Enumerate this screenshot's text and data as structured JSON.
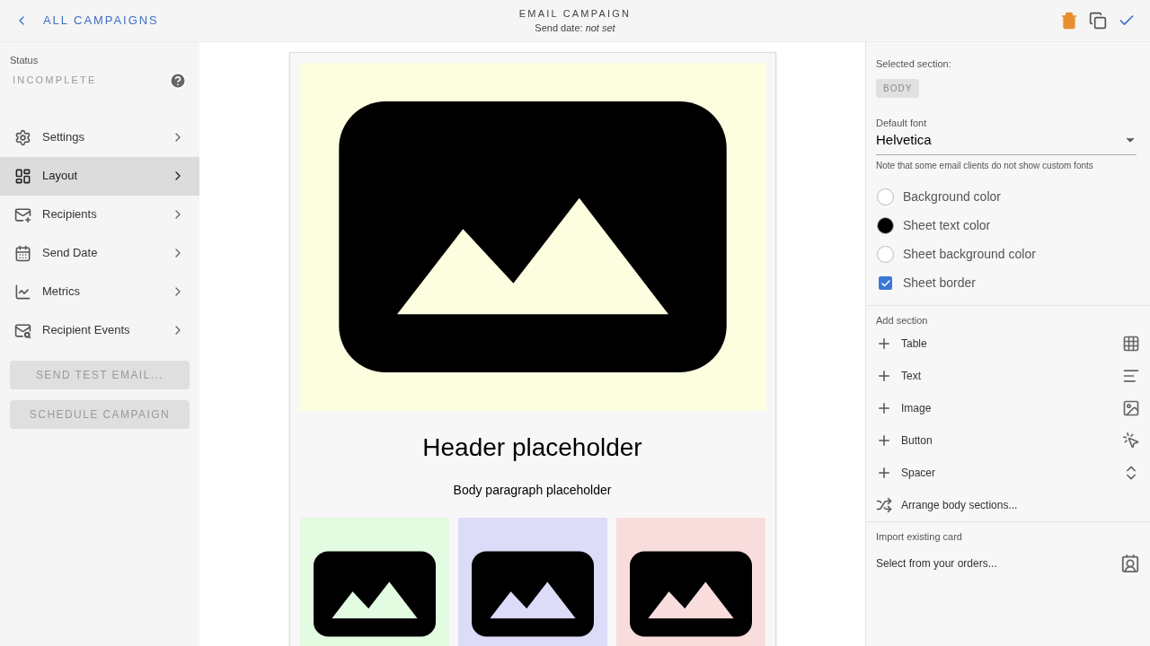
{
  "topbar": {
    "back_link": "ALL CAMPAIGNS",
    "title": "EMAIL CAMPAIGN",
    "subtitle": "Send date: *not set*"
  },
  "sidebar": {
    "status_label": "Status",
    "status": "INCOMPLETE",
    "items": [
      {
        "label": "Settings",
        "selected": false
      },
      {
        "label": "Layout",
        "selected": true
      },
      {
        "label": "Recipients",
        "selected": false
      },
      {
        "label": "Send Date",
        "selected": false
      },
      {
        "label": "Metrics",
        "selected": false
      },
      {
        "label": "Recipient Events",
        "selected": false
      }
    ],
    "buttons": [
      {
        "label": "SEND TEST EMAIL...",
        "disabled": true
      },
      {
        "label": "SCHEDULE CAMPAIGN",
        "disabled": true
      }
    ]
  },
  "email": {
    "header": "Header placeholder",
    "body": "Body paragraph placeholder",
    "tiles": [
      {
        "color": "#e3fbe0"
      },
      {
        "color": "#dcdcf8"
      },
      {
        "color": "#f9dddd"
      }
    ]
  },
  "panel": {
    "selected_label": "Selected section:",
    "selected_section": "BODY",
    "font_label": "Default font",
    "font_value": "Helvetica",
    "font_note": "Note that some email clients do not show custom fonts",
    "options": [
      {
        "kind": "swatch",
        "label": "Background color",
        "color": "#ffffff"
      },
      {
        "kind": "swatch",
        "label": "Sheet text color",
        "color": "#000000"
      },
      {
        "kind": "swatch",
        "label": "Sheet background color",
        "color": "#ffffff"
      },
      {
        "kind": "checkbox",
        "label": "Sheet border",
        "checked": true
      }
    ],
    "add_label": "Add section",
    "add_items": [
      {
        "label": "Table"
      },
      {
        "label": "Text"
      },
      {
        "label": "Image"
      },
      {
        "label": "Button"
      },
      {
        "label": "Spacer"
      }
    ],
    "arrange": "Arrange body sections...",
    "import_label": "Import existing card",
    "import_action": "Select from your orders..."
  }
}
